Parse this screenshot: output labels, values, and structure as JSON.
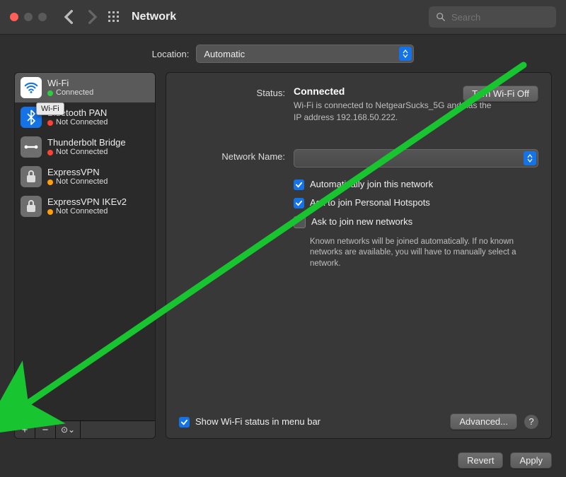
{
  "titlebar": {
    "title": "Network",
    "search_placeholder": "Search"
  },
  "location": {
    "label": "Location:",
    "value": "Automatic"
  },
  "sidebar": {
    "tooltip": "Wi-Fi",
    "services": [
      {
        "name": "Wi-Fi",
        "status": "Connected",
        "dot": "green",
        "icon": "wifi",
        "selected": true
      },
      {
        "name": "Bluetooth PAN",
        "status": "Not Connected",
        "dot": "red",
        "icon": "bt",
        "selected": false
      },
      {
        "name": "Thunderbolt Bridge",
        "status": "Not Connected",
        "dot": "red",
        "icon": "tb",
        "selected": false
      },
      {
        "name": "ExpressVPN",
        "status": "Not Connected",
        "dot": "orange",
        "icon": "vpn",
        "selected": false
      },
      {
        "name": "ExpressVPN IKEv2",
        "status": "Not Connected",
        "dot": "orange",
        "icon": "vpn",
        "selected": false
      }
    ],
    "footer": {
      "add": "+",
      "remove": "−",
      "actions": "⊙⌄"
    }
  },
  "main": {
    "status_label": "Status:",
    "status_value": "Connected",
    "status_sub": "Wi-Fi is connected to NetgearSucks_5G and has the IP address 192.168.50.222.",
    "wifi_off_btn": "Turn Wi-Fi Off",
    "network_name_label": "Network Name:",
    "network_name_value": "",
    "checks": {
      "auto_join": "Automatically join this network",
      "hotspots": "Ask to join Personal Hotspots",
      "new_networks": "Ask to join new networks",
      "new_networks_sub": "Known networks will be joined automatically. If no known networks are available, you will have to manually select a network."
    },
    "show_status_bar": "Show Wi-Fi status in menu bar",
    "advanced_btn": "Advanced...",
    "help": "?"
  },
  "bottom": {
    "revert": "Revert",
    "apply": "Apply"
  }
}
